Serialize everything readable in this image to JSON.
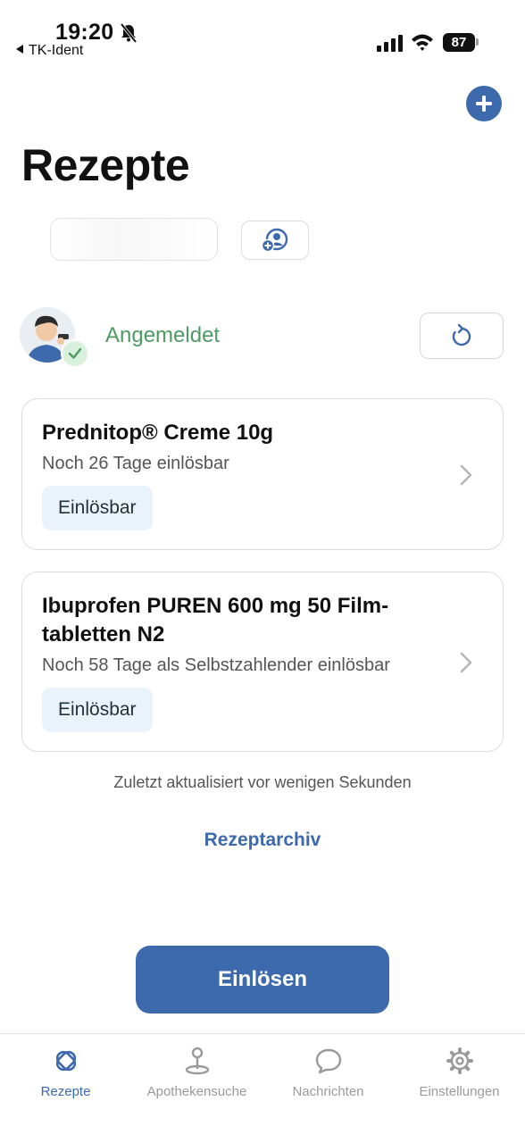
{
  "status_bar": {
    "time": "19:20",
    "back_app": "TK-Ident",
    "battery": "87"
  },
  "header": {
    "title": "Rezepte"
  },
  "session": {
    "status": "Angemeldet"
  },
  "prescriptions": [
    {
      "title": "Prednitop® Creme 10g",
      "subtitle": "Noch 26 Tage einlösbar",
      "badge": "Einlösbar"
    },
    {
      "title_line1": "Ibuprofen PUREN 600 mg 50 Film-",
      "title_line2": "tabletten N2",
      "subtitle": "Noch 58 Tage als Selbstzahlender einlösbar",
      "badge": "Einlösbar"
    }
  ],
  "last_updated": "Zuletzt aktualisiert vor wenigen Sekunden",
  "archive_link": "Rezeptarchiv",
  "redeem_button": "Einlösen",
  "tabs": [
    {
      "label": "Rezepte",
      "icon": "prescription-icon",
      "active": true
    },
    {
      "label": "Apothekensuche",
      "icon": "location-pin-icon",
      "active": false
    },
    {
      "label": "Nachrichten",
      "icon": "chat-bubble-icon",
      "active": false
    },
    {
      "label": "Einstellungen",
      "icon": "gear-icon",
      "active": false
    }
  ],
  "colors": {
    "accent": "#3d6aad",
    "success": "#4e9a62",
    "badge_bg": "#eaf3fb"
  }
}
